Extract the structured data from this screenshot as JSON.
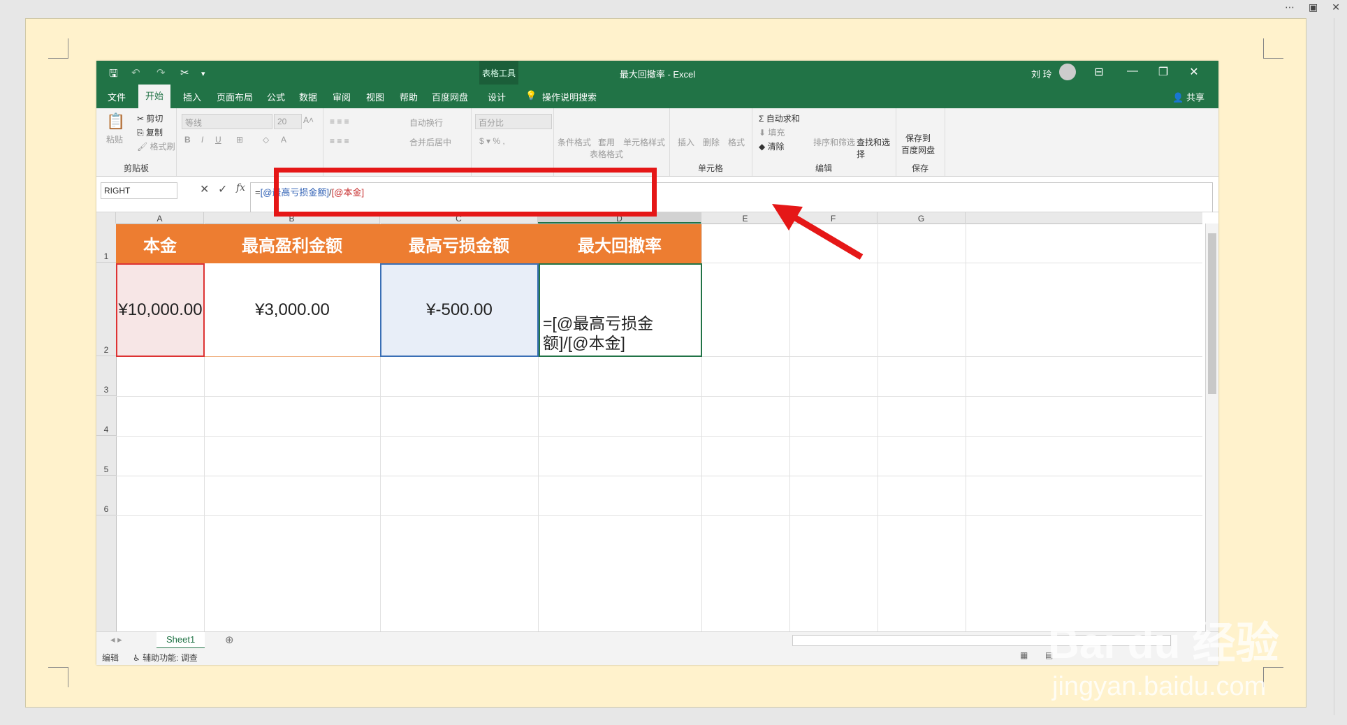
{
  "excel": {
    "title": "最大回撤率 - Excel",
    "context_label": "表格工具",
    "user": "刘 玲",
    "share": "共享",
    "tabs": [
      "文件",
      "开始",
      "插入",
      "页面布局",
      "公式",
      "数据",
      "审阅",
      "视图",
      "帮助",
      "百度网盘",
      "设计"
    ],
    "tell_me": "操作说明搜索"
  },
  "ribbon": {
    "clipboard": {
      "paste": "粘贴",
      "cut": "剪切",
      "copy": "复制",
      "format_painter": "格式刷",
      "label": "剪贴板"
    },
    "font": {
      "name": "等线",
      "size": "20"
    },
    "alignment": {
      "wrap": "自动换行",
      "merge": "合并后居中"
    },
    "number": {
      "format": "百分比"
    },
    "styles": {
      "conditional": "条件格式",
      "table_format": "套用\n表格格式",
      "cell_styles": "单元格样式"
    },
    "cells": {
      "insert": "插入",
      "delete": "删除",
      "format": "格式",
      "label": "单元格"
    },
    "editing": {
      "autosum": "自动求和",
      "fill": "填充",
      "clear": "清除",
      "sort": "排序和筛选",
      "find": "查找和选择",
      "label": "编辑"
    },
    "save": {
      "button": "保存到\n百度网盘",
      "label": "保存"
    }
  },
  "formula_bar": {
    "name_box": "RIGHT",
    "formula_parts": [
      "=",
      "[@最高亏损金额]",
      "/",
      "[@本金]"
    ]
  },
  "columns": [
    "A",
    "B",
    "C",
    "D",
    "E",
    "F",
    "G"
  ],
  "rows": [
    "1",
    "2",
    "3",
    "4",
    "5",
    "6"
  ],
  "table": {
    "headers": [
      "本金",
      "最高盈利金额",
      "最高亏损金额",
      "最大回撤率"
    ],
    "row2": [
      "¥10,000.00",
      "¥3,000.00",
      "¥-500.00",
      "=[@最高亏损金额]/[@本金]"
    ]
  },
  "sheet": {
    "tab": "Sheet1"
  },
  "status": {
    "mode": "编辑",
    "accessibility": "辅助功能: 调查"
  },
  "watermark": {
    "brand": "Bai du 经验",
    "url": "jingyan.baidu.com"
  },
  "colors": {
    "excel_green": "#217346",
    "table_header": "#ed7d31",
    "callout": "#e51717"
  }
}
